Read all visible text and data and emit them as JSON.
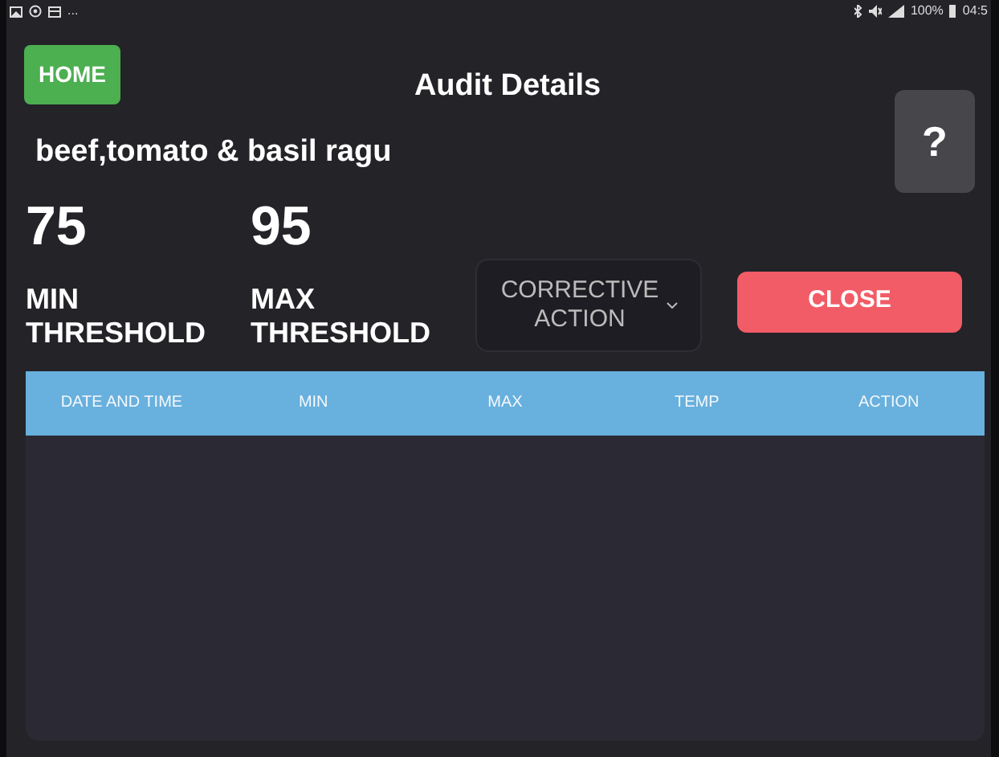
{
  "status_bar": {
    "notification_more": "...",
    "battery": "100%",
    "time": "04:5"
  },
  "home_button": "HOME",
  "title": "Audit Details",
  "help_button": "?",
  "item_name": "beef,tomato & basil ragu",
  "thresholds": [
    {
      "value": "75",
      "label": "MIN THRESHOLD"
    },
    {
      "value": "95",
      "label": "MAX THRESHOLD"
    }
  ],
  "corrective_action": {
    "label": "CORRECTIVE ACTION"
  },
  "close_button": "CLOSE",
  "table": {
    "columns": [
      "DATE AND TIME",
      "MIN",
      "MAX",
      "TEMP",
      "ACTION"
    ]
  }
}
